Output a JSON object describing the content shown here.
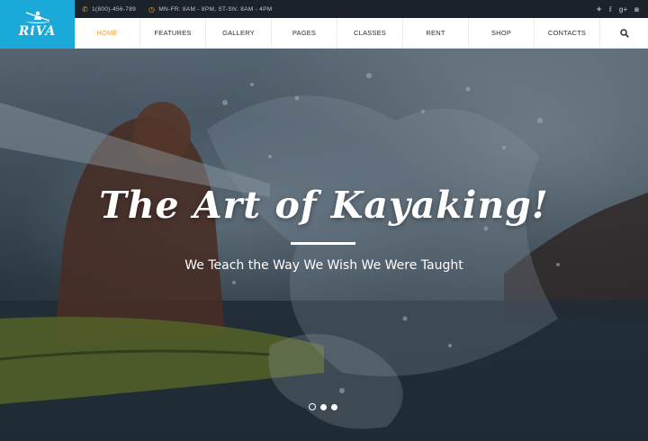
{
  "brand": {
    "logo_text": "RiVA"
  },
  "topbar": {
    "phone": "1(800)-456-789",
    "hours": "MN-FR: 8AM - 8PM, ST-SN: 8AM - 4PM",
    "socials": [
      "twitter-icon",
      "facebook-icon",
      "google-plus-icon",
      "instagram-icon"
    ]
  },
  "nav": {
    "items": [
      {
        "label": "HOME",
        "active": true
      },
      {
        "label": "FEATURES"
      },
      {
        "label": "GALLERY"
      },
      {
        "label": "PAGES"
      },
      {
        "label": "CLASSES"
      },
      {
        "label": "RENT"
      },
      {
        "label": "SHOP"
      },
      {
        "label": "CONTACTS"
      }
    ]
  },
  "hero": {
    "title": "The Art of Kayaking!",
    "subtitle": "We Teach the Way We Wish We Were Taught",
    "slide_count": 3,
    "active_slide": 1
  },
  "colors": {
    "accent": "#f0a33a",
    "logo_bg": "#1aa9d8",
    "topbar_bg": "#1b2229"
  }
}
